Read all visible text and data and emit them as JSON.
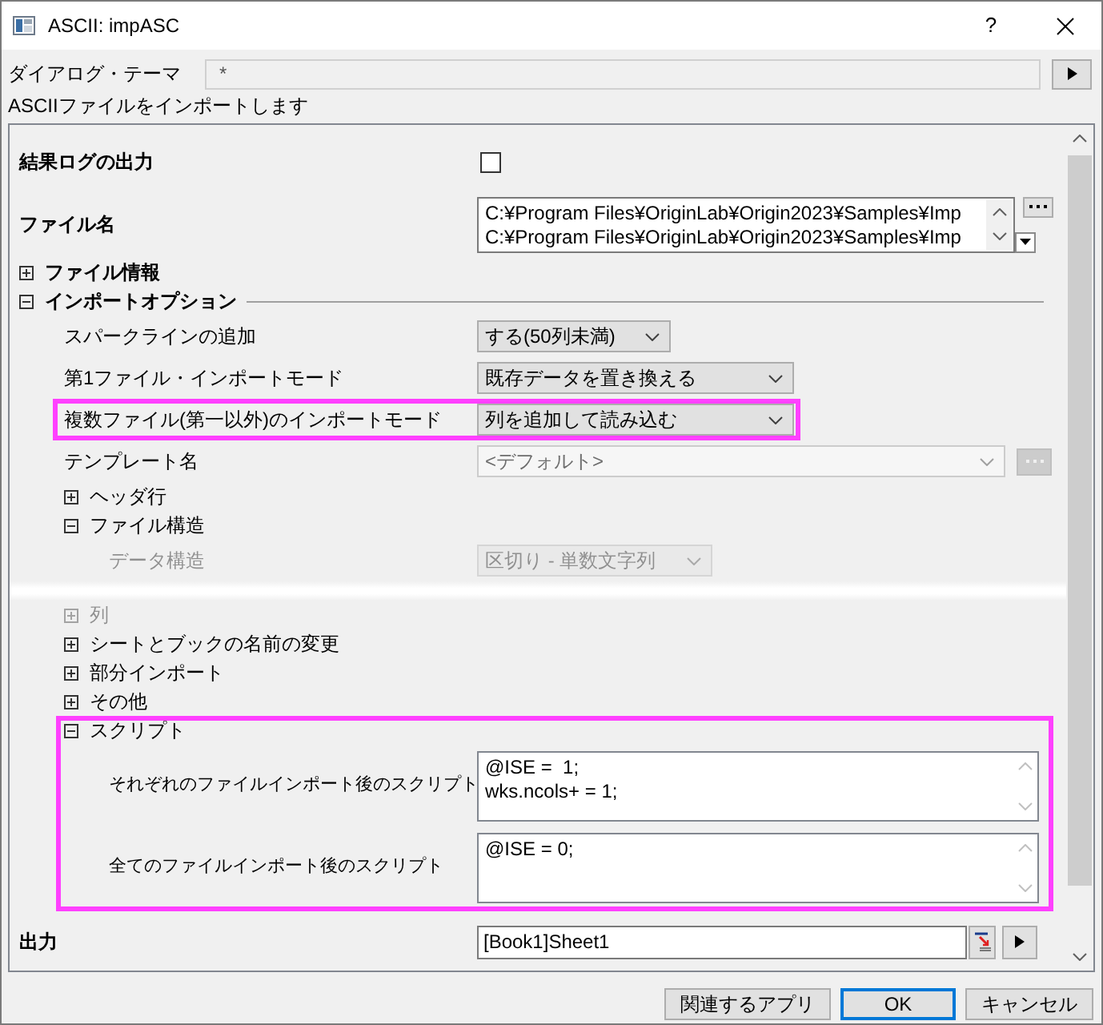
{
  "window": {
    "title": "ASCII: impASC",
    "help": "?"
  },
  "theme": {
    "label": "ダイアログ・テーマ",
    "value": "*"
  },
  "description": "ASCIIファイルをインポートします",
  "tree": [
    {
      "kind": "checkbox",
      "label": "結果ログの出力",
      "checked": false
    },
    {
      "kind": "files",
      "label": "ファイル名",
      "lines": [
        "C:¥Program Files¥OriginLab¥Origin2023¥Samples¥Imp",
        "C:¥Program Files¥OriginLab¥Origin2023¥Samples¥Imp"
      ]
    },
    {
      "kind": "group",
      "label": "ファイル情報",
      "expanded": false
    },
    {
      "kind": "group",
      "label": "インポートオプション",
      "expanded": true,
      "children": [
        {
          "kind": "dropdown",
          "label": "スパークラインの追加",
          "value": "する(50列未満)",
          "disabled": false,
          "faded": false,
          "highlighted": false
        },
        {
          "kind": "dropdown",
          "label": "第1ファイル・インポートモード",
          "value": "既存データを置き換える",
          "disabled": false,
          "faded": false,
          "highlighted": false
        },
        {
          "kind": "dropdown",
          "label": "複数ファイル(第一以外)のインポートモード",
          "value": "列を追加して読み込む",
          "disabled": false,
          "faded": false,
          "highlighted": true
        },
        {
          "kind": "combo",
          "label": "テンプレート名",
          "value": "<デフォルト>",
          "disabled": true,
          "faded": false,
          "highlighted": false
        },
        {
          "kind": "group",
          "label": "ヘッダ行",
          "expanded": false,
          "faded": false,
          "highlighted": false
        },
        {
          "kind": "group",
          "label": "ファイル構造",
          "expanded": true,
          "faded": false,
          "highlighted": false,
          "children": [
            {
              "kind": "dropdown",
              "label": "データ構造",
              "value": "区切り - 単数文字列",
              "disabled": false,
              "faded": true
            }
          ]
        },
        {
          "kind": "gap"
        },
        {
          "kind": "group",
          "label": "列",
          "expanded": false,
          "faded": true,
          "highlighted": false
        },
        {
          "kind": "group",
          "label": "シートとブックの名前の変更",
          "expanded": false,
          "faded": false,
          "highlighted": false
        },
        {
          "kind": "group",
          "label": "部分インポート",
          "expanded": false,
          "faded": false,
          "highlighted": false
        },
        {
          "kind": "group",
          "label": "その他",
          "expanded": false,
          "faded": false,
          "highlighted": false
        },
        {
          "kind": "group",
          "label": "スクリプト",
          "expanded": true,
          "faded": false,
          "highlighted": true,
          "children": [
            {
              "kind": "textarea",
              "label": "それぞれのファイルインポート後のスクリプト",
              "lines": [
                "@ISE =  1;",
                "wks.ncols+ = 1;"
              ]
            },
            {
              "kind": "textarea",
              "label": "全てのファイルインポート後のスクリプト",
              "lines": [
                "@ISE = 0;"
              ]
            }
          ]
        }
      ]
    },
    {
      "kind": "output",
      "label": "出力",
      "value": "[Book1]Sheet1"
    }
  ],
  "buttons": [
    {
      "label": "関連するアプリ",
      "default": false
    },
    {
      "label": "OK",
      "default": true
    },
    {
      "label": "キャンセル",
      "default": false
    }
  ]
}
